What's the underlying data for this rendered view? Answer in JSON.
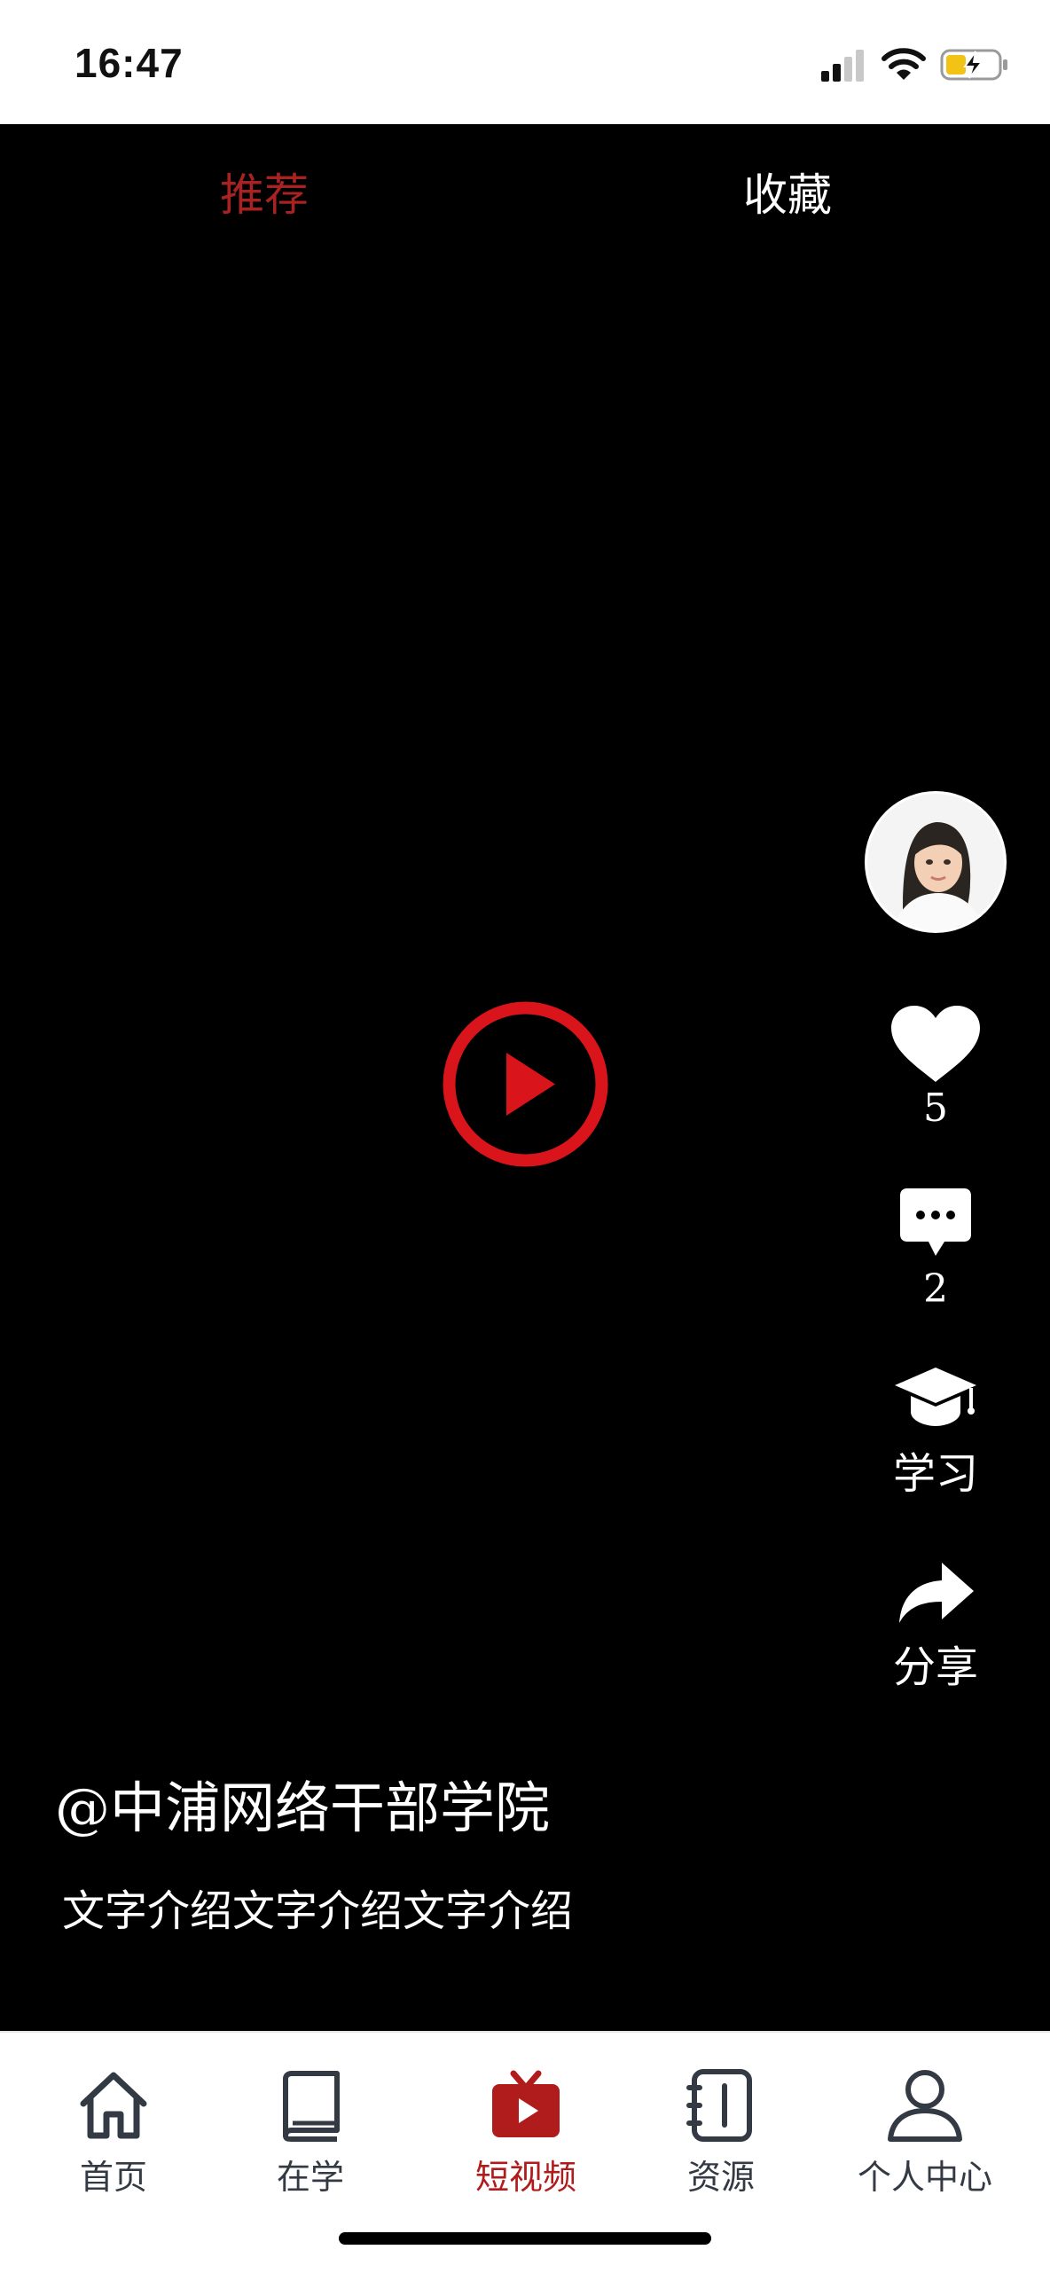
{
  "status_bar": {
    "time": "16:47",
    "icons": [
      "signal-icon",
      "wifi-icon",
      "battery-charging-icon"
    ]
  },
  "top_tabs": [
    {
      "label": "推荐",
      "active": true
    },
    {
      "label": "收藏",
      "active": false
    }
  ],
  "video": {
    "play_icon": "play-icon",
    "author": "@中浦网络干部学院",
    "description": "文字介绍文字介绍文字介绍"
  },
  "side_actions": {
    "like_count": "5",
    "comment_count": "2",
    "study_label": "学习",
    "share_label": "分享"
  },
  "bottom_nav": [
    {
      "label": "首页",
      "icon": "home-icon",
      "active": false
    },
    {
      "label": "在学",
      "icon": "book-icon",
      "active": false
    },
    {
      "label": "短视频",
      "icon": "tv-icon",
      "active": true
    },
    {
      "label": "资源",
      "icon": "notebook-icon",
      "active": false
    },
    {
      "label": "个人中心",
      "icon": "user-icon",
      "active": false
    }
  ],
  "colors": {
    "accent": "#b01c1c",
    "play": "#d9141b",
    "background_video": "#000000"
  }
}
